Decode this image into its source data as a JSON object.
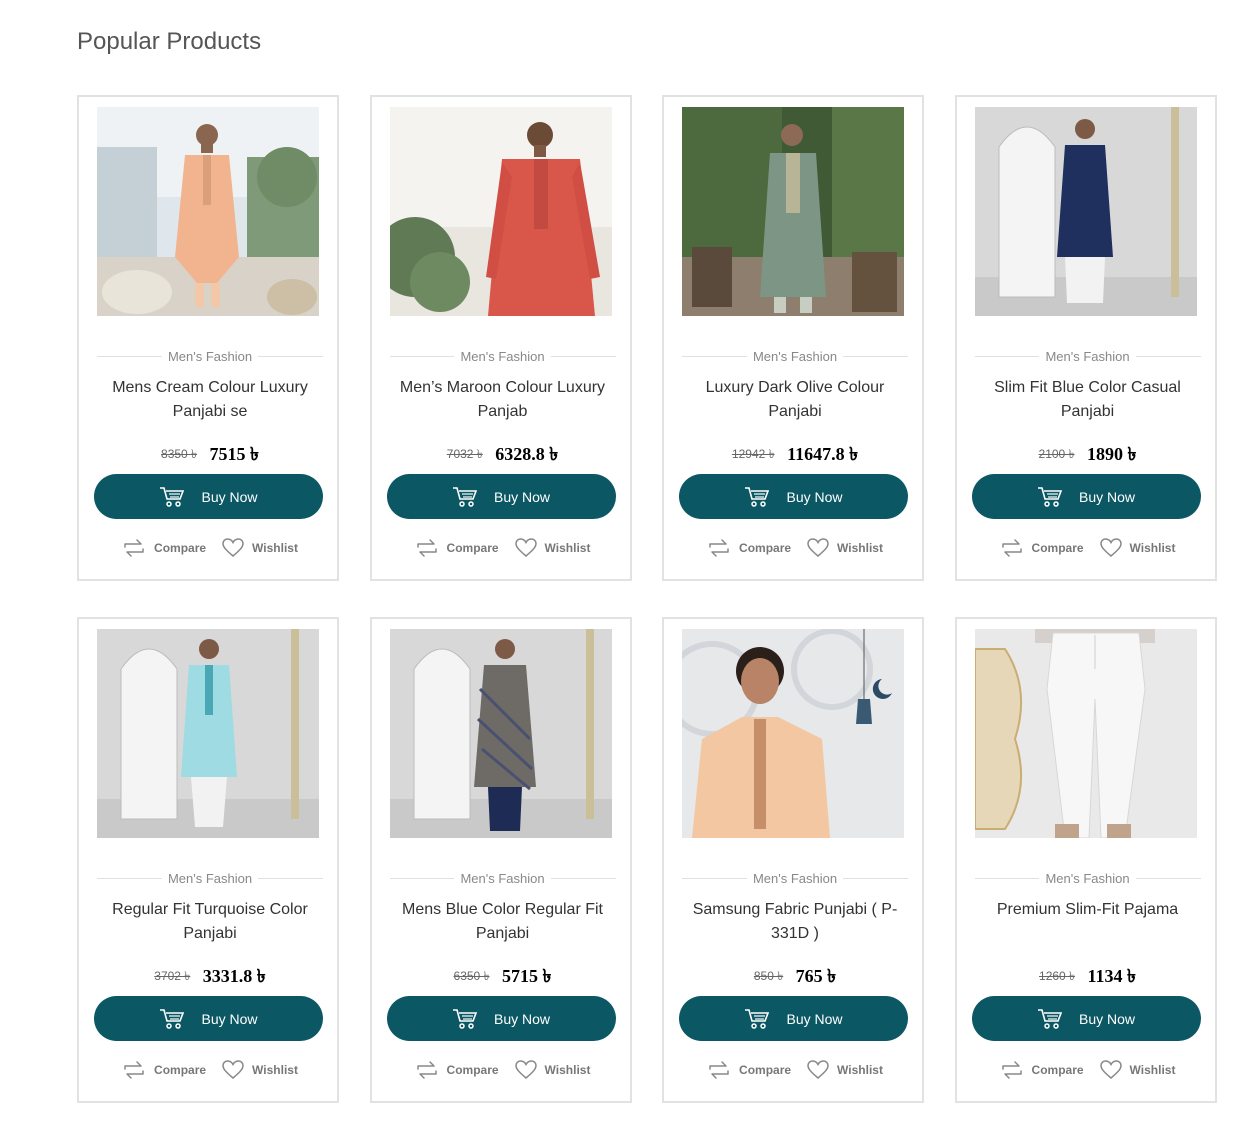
{
  "section": {
    "title": "Popular Products"
  },
  "labels": {
    "buy_now": "Buy Now",
    "compare": "Compare",
    "wishlist": "Wishlist"
  },
  "colors": {
    "button_bg": "#0b5864",
    "border": "#e2e2e2"
  },
  "products": [
    {
      "category": "Men's Fashion",
      "name": "Mens Cream Colour Luxury Panjabi se",
      "old_price": "8350 ৳",
      "new_price": "7515 ৳"
    },
    {
      "category": "Men's Fashion",
      "name": "Men’s Maroon Colour Luxury Panjab",
      "old_price": "7032 ৳",
      "new_price": "6328.8 ৳"
    },
    {
      "category": "Men's Fashion",
      "name": "Luxury Dark Olive Colour Panjabi",
      "old_price": "12942 ৳",
      "new_price": "11647.8 ৳"
    },
    {
      "category": "Men's Fashion",
      "name": "Slim Fit Blue Color Casual Panjabi",
      "old_price": "2100 ৳",
      "new_price": "1890 ৳"
    },
    {
      "category": "Men's Fashion",
      "name": "Regular Fit Turquoise Color Panjabi",
      "old_price": "3702 ৳",
      "new_price": "3331.8 ৳"
    },
    {
      "category": "Men's Fashion",
      "name": "Mens Blue Color Regular Fit Panjabi",
      "old_price": "6350 ৳",
      "new_price": "5715 ৳"
    },
    {
      "category": "Men's Fashion",
      "name": "Samsung Fabric Punjabi ( P-331D )",
      "old_price": "850 ৳",
      "new_price": "765 ৳"
    },
    {
      "category": "Men's Fashion",
      "name": "Premium Slim-Fit Pajama",
      "old_price": "1260 ৳",
      "new_price": "1134 ৳"
    }
  ]
}
